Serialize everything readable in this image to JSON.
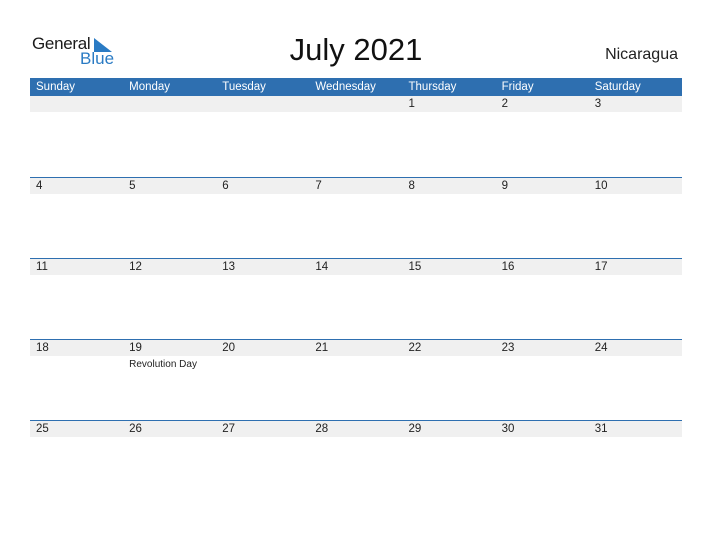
{
  "logo": {
    "line1": "General",
    "line2": "Blue"
  },
  "title": "July 2021",
  "country": "Nicaragua",
  "colors": {
    "accent": "#2e6fb0",
    "date_row_bg": "#f0f0f0"
  },
  "weekdays": [
    "Sunday",
    "Monday",
    "Tuesday",
    "Wednesday",
    "Thursday",
    "Friday",
    "Saturday"
  ],
  "weeks": [
    {
      "days": [
        "",
        "",
        "",
        "",
        "1",
        "2",
        "3"
      ],
      "holidays": [
        "",
        "",
        "",
        "",
        "",
        "",
        ""
      ]
    },
    {
      "days": [
        "4",
        "5",
        "6",
        "7",
        "8",
        "9",
        "10"
      ],
      "holidays": [
        "",
        "",
        "",
        "",
        "",
        "",
        ""
      ]
    },
    {
      "days": [
        "11",
        "12",
        "13",
        "14",
        "15",
        "16",
        "17"
      ],
      "holidays": [
        "",
        "",
        "",
        "",
        "",
        "",
        ""
      ]
    },
    {
      "days": [
        "18",
        "19",
        "20",
        "21",
        "22",
        "23",
        "24"
      ],
      "holidays": [
        "",
        "Revolution Day",
        "",
        "",
        "",
        "",
        ""
      ]
    },
    {
      "days": [
        "25",
        "26",
        "27",
        "28",
        "29",
        "30",
        "31"
      ],
      "holidays": [
        "",
        "",
        "",
        "",
        "",
        "",
        ""
      ]
    }
  ]
}
